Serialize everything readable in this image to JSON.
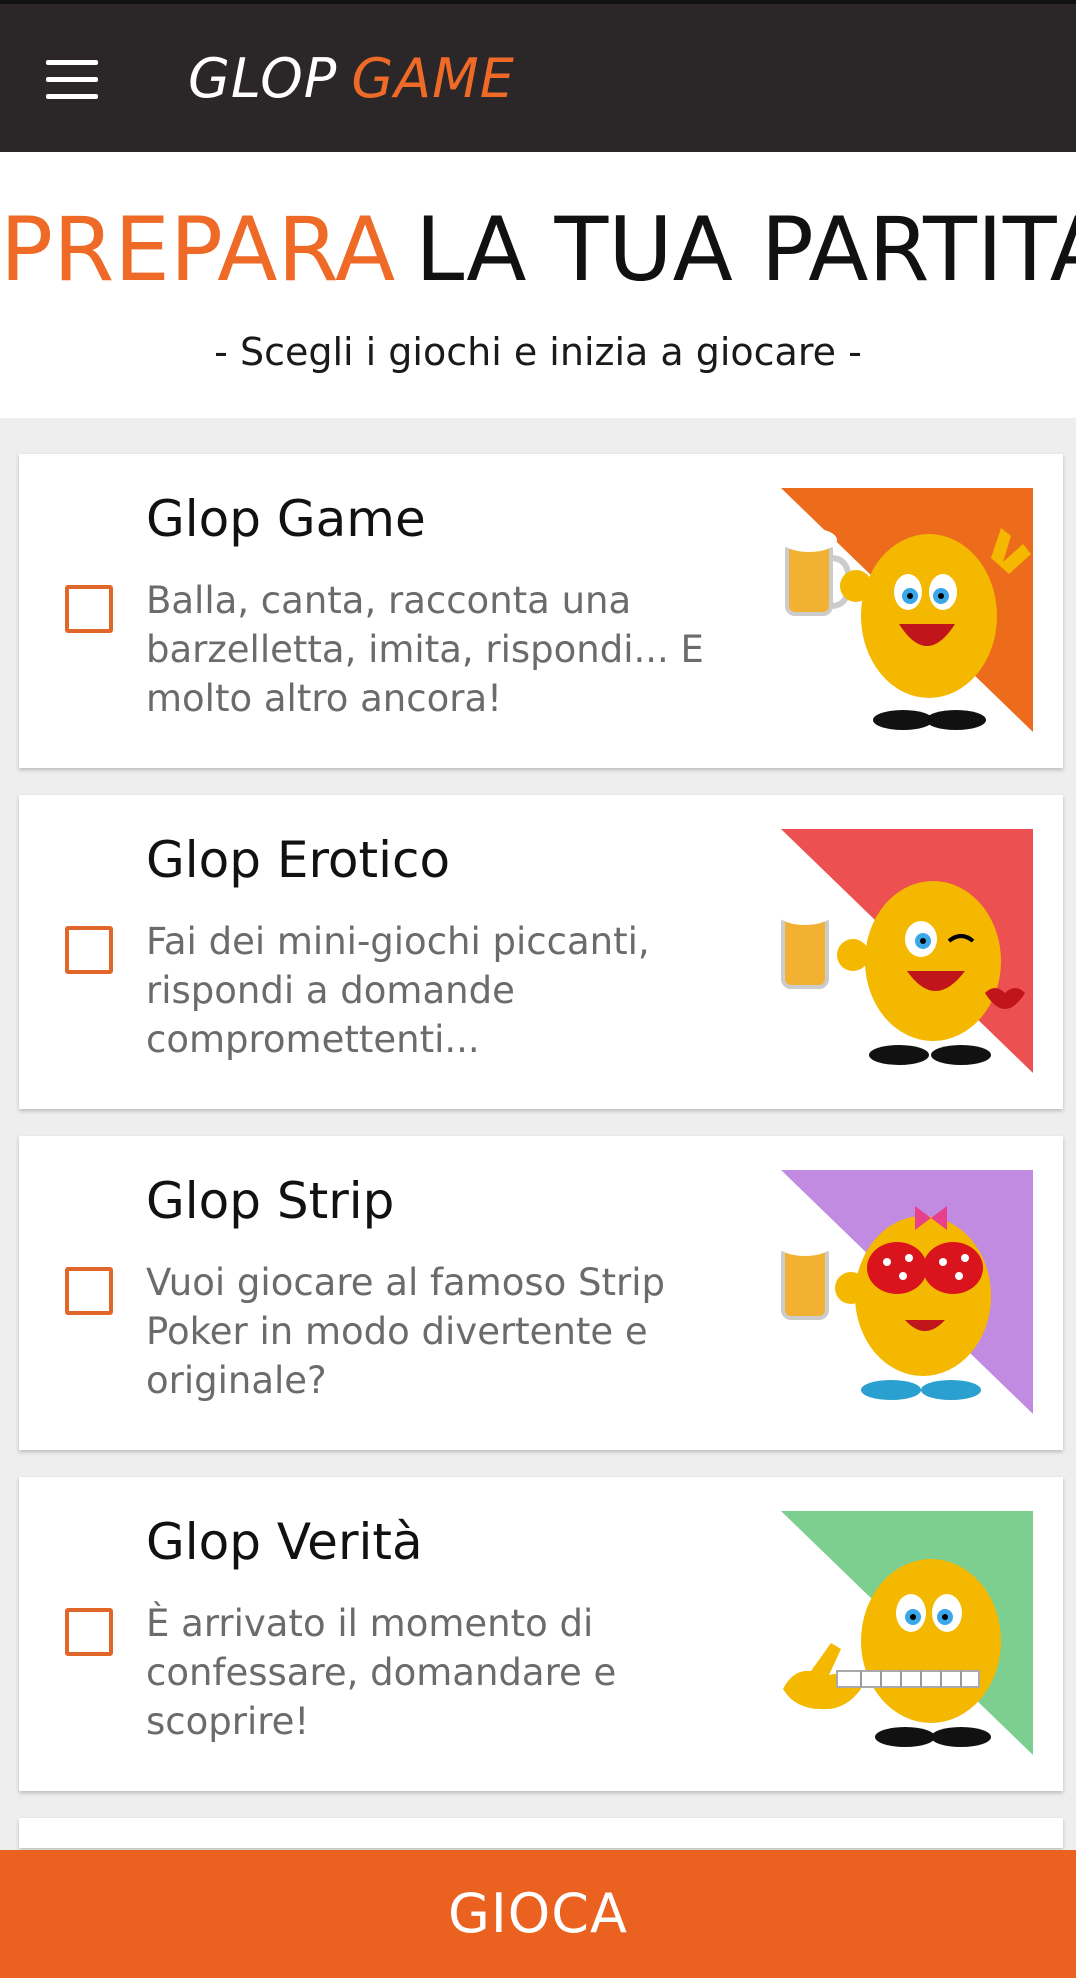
{
  "app": {
    "logo_part1": "GLOP",
    "logo_part2": "GAME",
    "menu_icon": "hamburger-menu-icon"
  },
  "header": {
    "title_accent": "PREPARA",
    "title_rest": "LA TUA PARTITA",
    "subtitle": "- Scegli i giochi e inizia a giocare -"
  },
  "games": [
    {
      "title": "Glop Game",
      "description": "Balla, canta, racconta una barzelletta, imita, rispondi... E molto altro ancora!",
      "checked": false,
      "accent_color": "#ec6c1c",
      "image": "mascot-beer-peace-icon"
    },
    {
      "title": "Glop Erotico",
      "description": "Fai dei mini-giochi piccanti, rispondi a domande compromettenti...",
      "checked": false,
      "accent_color": "#ec5050",
      "image": "mascot-wink-kiss-icon"
    },
    {
      "title": "Glop Strip",
      "description": "Vuoi giocare al famoso Strip Poker in modo divertente e originale?",
      "checked": false,
      "accent_color": "#c08be0",
      "image": "mascot-bikini-icon"
    },
    {
      "title": "Glop Verità",
      "description": "È arrivato il momento di confessare, domandare e scoprire!",
      "checked": false,
      "accent_color": "#7dcf8f",
      "image": "mascot-zipped-mouth-icon"
    }
  ],
  "footer": {
    "play_label": "GIOCA"
  },
  "colors": {
    "brand_orange": "#ea6120",
    "topbar": "#2b2628"
  }
}
